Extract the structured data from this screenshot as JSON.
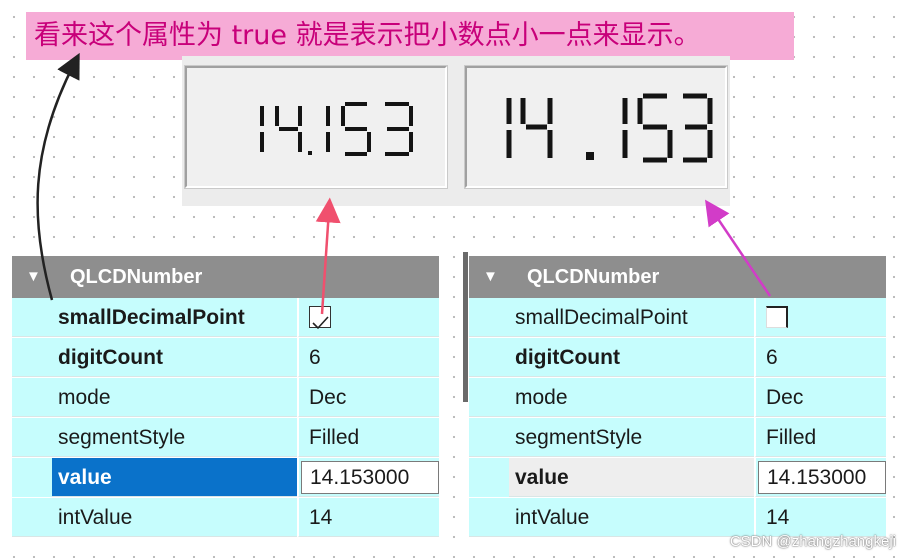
{
  "annotation": {
    "text": "看来这个属性为 true 就是表示把小数点小一点来显示。",
    "color": "#c8007a",
    "background": "#f6abd6"
  },
  "lcd_displays": [
    {
      "name": "small-decimal-display",
      "value": "14.153",
      "small_decimal_point": true
    },
    {
      "name": "normal-decimal-display",
      "value": "14.153",
      "small_decimal_point": false
    }
  ],
  "panels": {
    "left": {
      "title": "QLCDNumber",
      "rows": [
        {
          "key": "smallDecimalPoint",
          "value": "",
          "checked": true,
          "bold": true
        },
        {
          "key": "digitCount",
          "value": "6",
          "bold": true
        },
        {
          "key": "mode",
          "value": "Dec",
          "bold": false
        },
        {
          "key": "segmentStyle",
          "value": "Filled",
          "bold": false
        },
        {
          "key": "value",
          "value": "14.153000",
          "bold": true,
          "selected": true
        },
        {
          "key": "intValue",
          "value": "14",
          "bold": false
        }
      ]
    },
    "right": {
      "title": "QLCDNumber",
      "rows": [
        {
          "key": "smallDecimalPoint",
          "value": "",
          "checked": false,
          "bold": false
        },
        {
          "key": "digitCount",
          "value": "6",
          "bold": true
        },
        {
          "key": "mode",
          "value": "Dec",
          "bold": false
        },
        {
          "key": "segmentStyle",
          "value": "Filled",
          "bold": false
        },
        {
          "key": "value",
          "value": "14.153000",
          "bold": true,
          "selected": false
        },
        {
          "key": "intValue",
          "value": "14",
          "bold": false
        }
      ]
    }
  },
  "icons": {
    "expand": "chevron-down-icon",
    "checked": "checkmark-icon"
  },
  "arrow_colors": {
    "black": "#222222",
    "red": "#f0506e",
    "magenta": "#d23cc8"
  },
  "watermark": "CSDN @zhangzhangkeji"
}
